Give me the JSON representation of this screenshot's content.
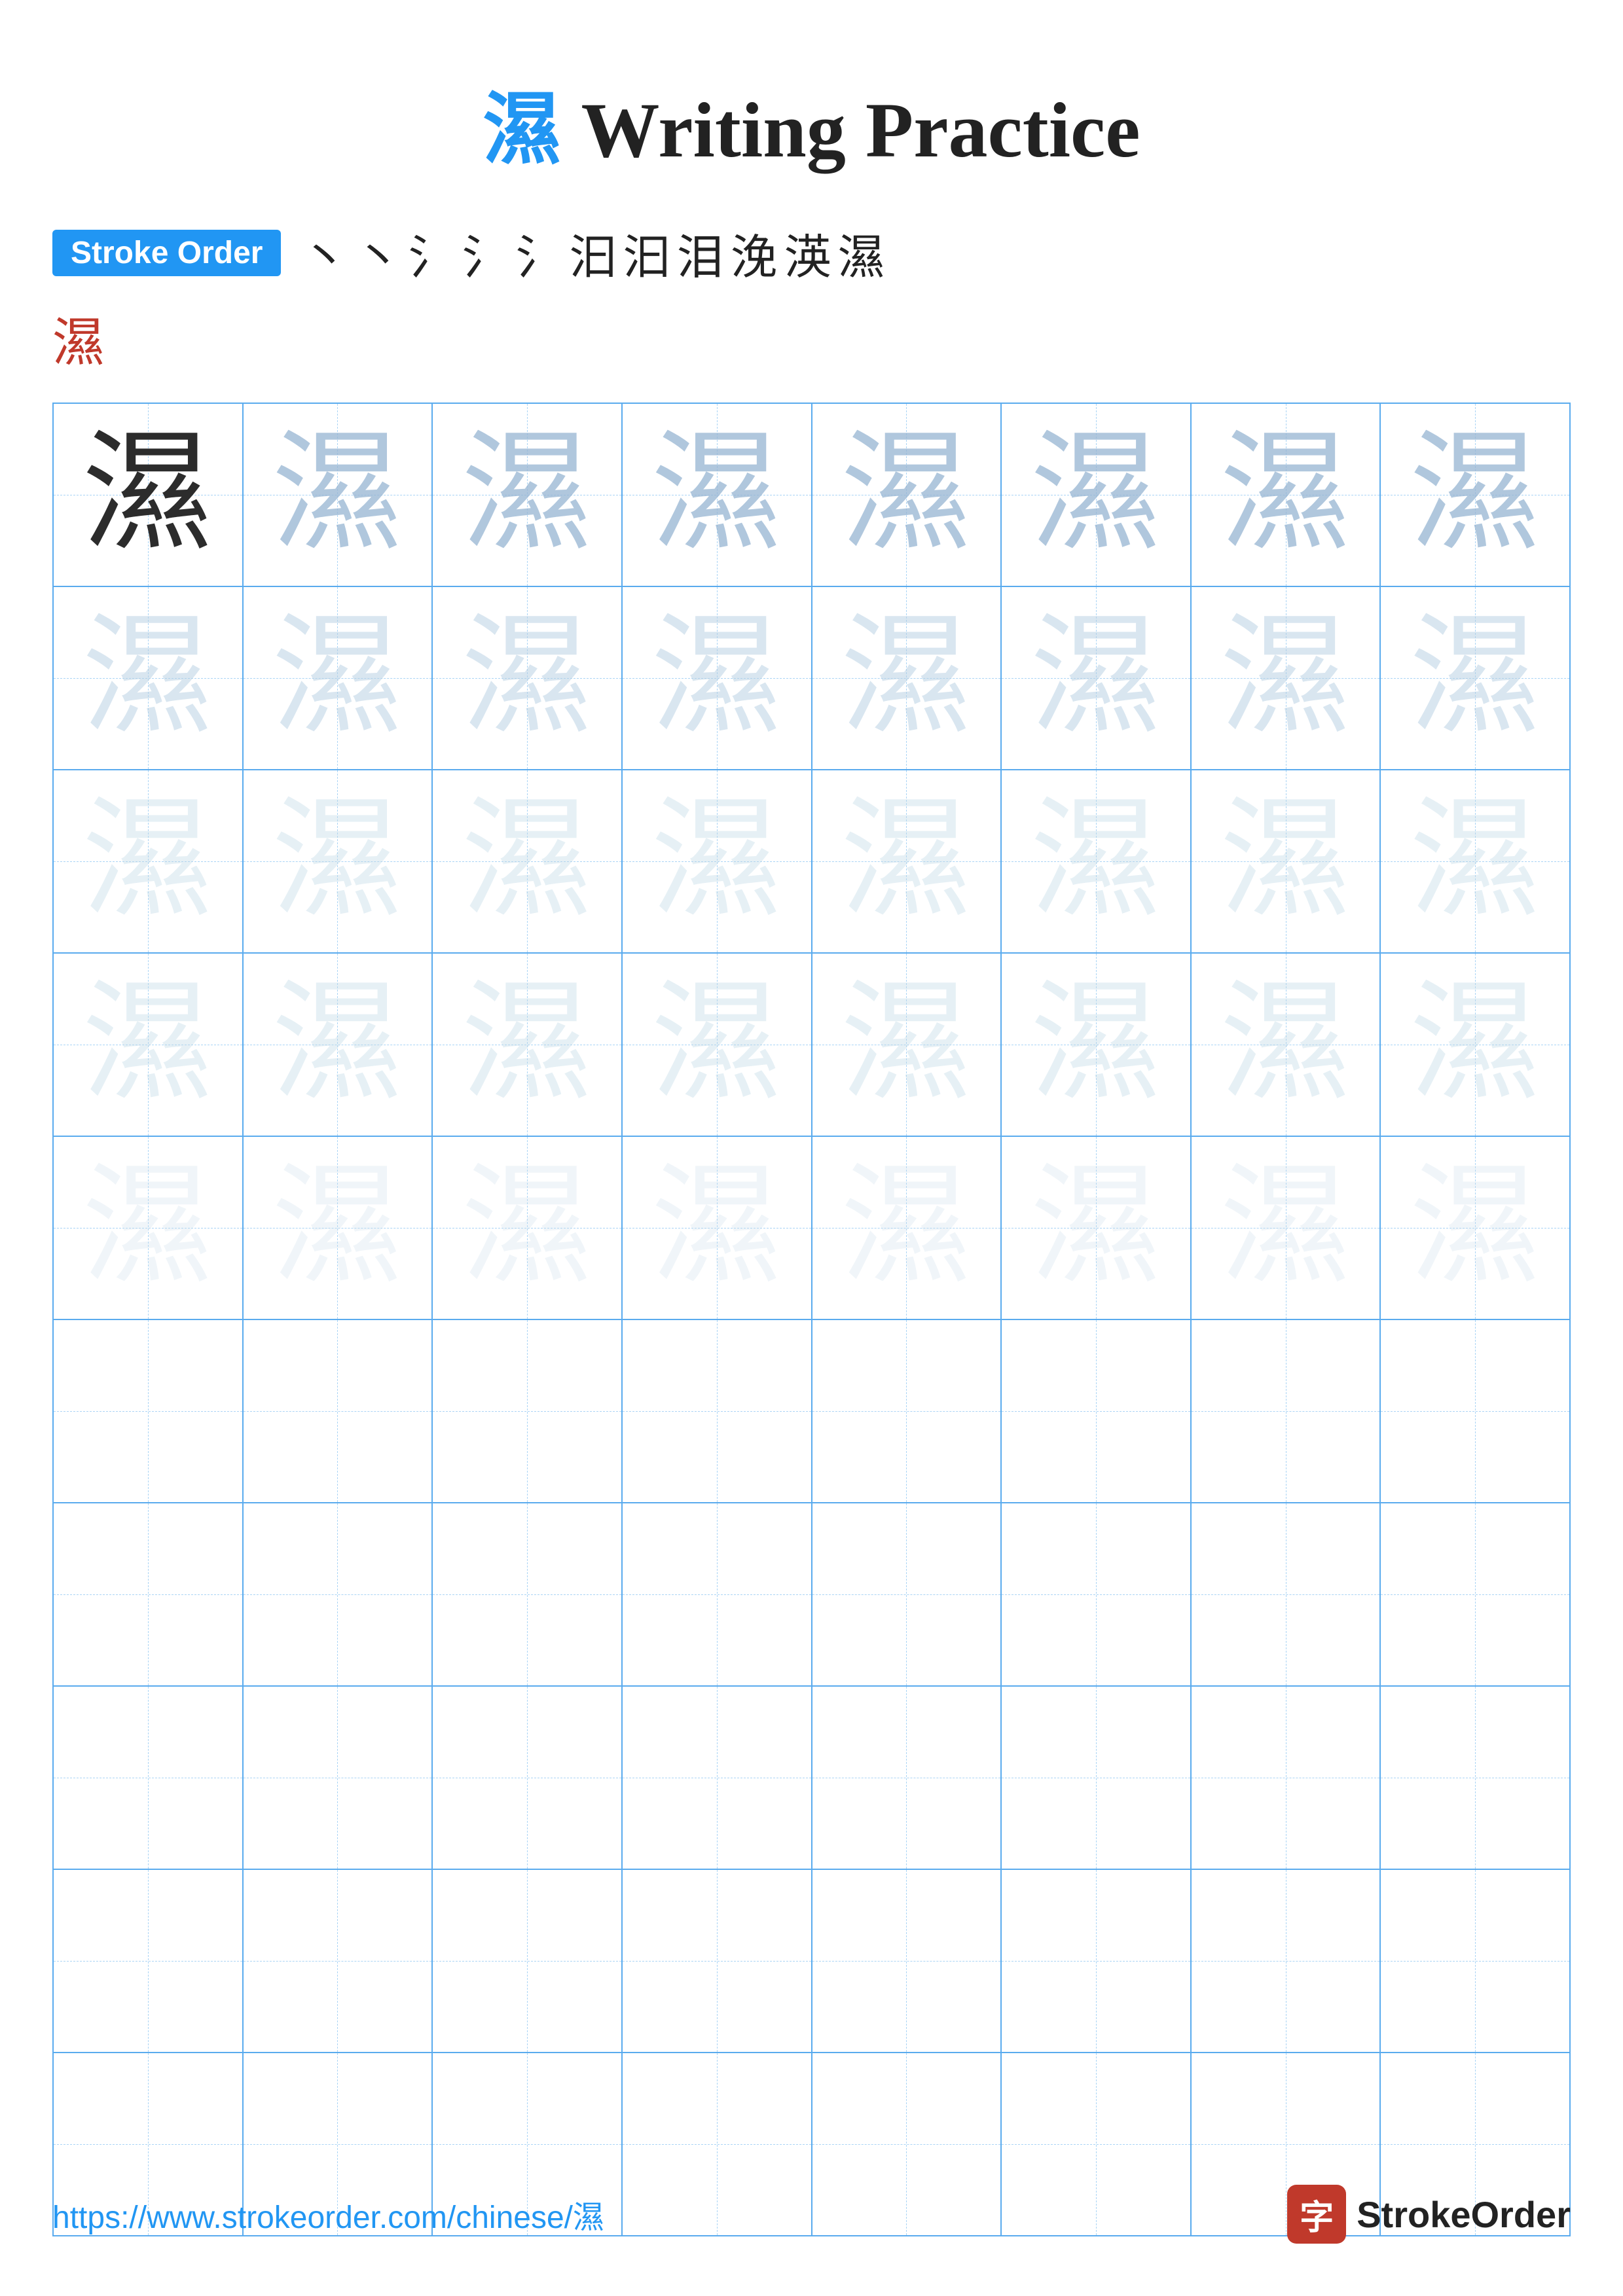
{
  "title": {
    "char": "濕",
    "label": "Writing Practice"
  },
  "stroke_order": {
    "badge": "Stroke Order",
    "steps": [
      "丶",
      "丶",
      "氵",
      "氵",
      "氵",
      "汩",
      "汩",
      "泪",
      "浼",
      "渶",
      "濕"
    ],
    "final_char": "濕"
  },
  "grid": {
    "char": "濕",
    "rows": 10,
    "cols": 8,
    "shading": [
      [
        "dark",
        "medium",
        "medium",
        "medium",
        "medium",
        "medium",
        "medium",
        "medium"
      ],
      [
        "light",
        "light",
        "light",
        "light",
        "light",
        "light",
        "light",
        "light"
      ],
      [
        "lighter",
        "lighter",
        "lighter",
        "lighter",
        "lighter",
        "lighter",
        "lighter",
        "lighter"
      ],
      [
        "lighter",
        "lighter",
        "lighter",
        "lighter",
        "lighter",
        "lighter",
        "lighter",
        "lighter"
      ],
      [
        "lightest",
        "lightest",
        "lightest",
        "lightest",
        "lightest",
        "lightest",
        "lightest",
        "lightest"
      ],
      [
        "empty",
        "empty",
        "empty",
        "empty",
        "empty",
        "empty",
        "empty",
        "empty"
      ],
      [
        "empty",
        "empty",
        "empty",
        "empty",
        "empty",
        "empty",
        "empty",
        "empty"
      ],
      [
        "empty",
        "empty",
        "empty",
        "empty",
        "empty",
        "empty",
        "empty",
        "empty"
      ],
      [
        "empty",
        "empty",
        "empty",
        "empty",
        "empty",
        "empty",
        "empty",
        "empty"
      ],
      [
        "empty",
        "empty",
        "empty",
        "empty",
        "empty",
        "empty",
        "empty",
        "empty"
      ]
    ]
  },
  "footer": {
    "url": "https://www.strokeorder.com/chinese/濕",
    "brand_icon_char": "字",
    "brand_name": "StrokeOrder"
  }
}
